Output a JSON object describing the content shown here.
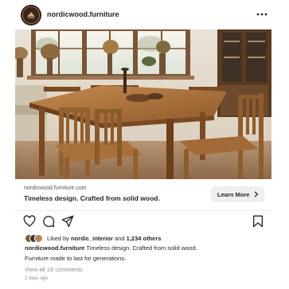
{
  "post": {
    "username": "nordicwood.furniture",
    "avatar_text": "NORDIC WOOD"
  },
  "link": {
    "domain": "nordicwood.furniture.com",
    "headline": "Timeless design. Crafted from solid wood.",
    "cta_label": "Learn More"
  },
  "actions": {
    "like_icon": "heart-icon",
    "comment_icon": "comment-icon",
    "share_icon": "send-icon",
    "save_icon": "bookmark-icon"
  },
  "likes": {
    "prefix": "Liked by",
    "user": "nordic_interior",
    "and": "and",
    "count": "1,234 others"
  },
  "caption": {
    "username": "nordicwood.furniture",
    "text": "Timeless design. Crafted from solid wood.",
    "line2": "Furniture made to last for generations."
  },
  "comments": {
    "view_all": "View all 18 comments"
  },
  "time": "2 days ago",
  "colors": {
    "text": "#262626",
    "muted": "#8e8e8e",
    "button_bg": "#efefef",
    "avatar_bg": "#3b2418"
  }
}
